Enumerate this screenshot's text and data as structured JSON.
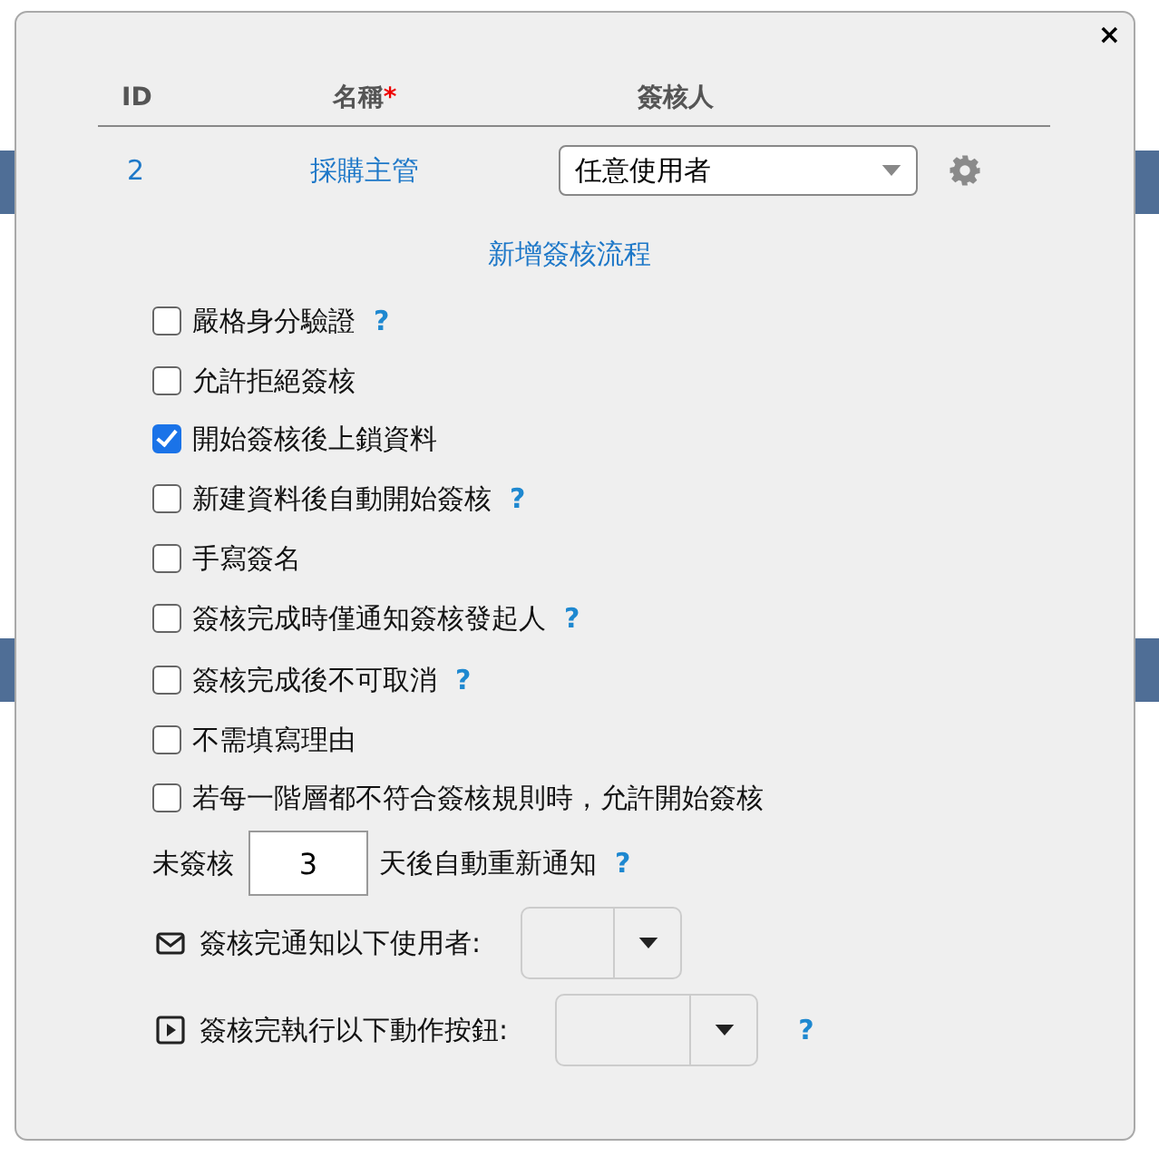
{
  "dialog": {
    "close": "×",
    "table": {
      "columns": [
        {
          "label": "ID",
          "required": false
        },
        {
          "label": "名稱",
          "required": true
        },
        {
          "label": "簽核人",
          "required": false
        }
      ],
      "required_mark": "*",
      "rows": [
        {
          "id": "2",
          "name": "採購主管",
          "approver": "任意使用者"
        }
      ]
    },
    "add_link": "新增簽核流程",
    "options": [
      {
        "label": "嚴格身分驗證",
        "checked": false,
        "help": "?"
      },
      {
        "label": "允許拒絕簽核",
        "checked": false
      },
      {
        "label": "開始簽核後上鎖資料",
        "checked": true
      },
      {
        "label": "新建資料後自動開始簽核",
        "checked": false,
        "help": "?"
      },
      {
        "label": "手寫簽名",
        "checked": false
      },
      {
        "label": "簽核完成時僅通知簽核發起人",
        "checked": false,
        "help": "?"
      },
      {
        "label": "簽核完成後不可取消",
        "checked": false,
        "help": "?"
      },
      {
        "label": "不需填寫理由",
        "checked": false
      },
      {
        "label": "若每一階層都不符合簽核規則時，允許開始簽核",
        "checked": false
      }
    ],
    "reminder": {
      "before": "未簽核",
      "value": "3",
      "after": "天後自動重新通知",
      "help": "?"
    },
    "actions": [
      {
        "kind": "mail",
        "label": "簽核完通知以下使用者:"
      },
      {
        "kind": "run",
        "label": "簽核完執行以下動作按鈕:",
        "help": "?"
      }
    ]
  }
}
